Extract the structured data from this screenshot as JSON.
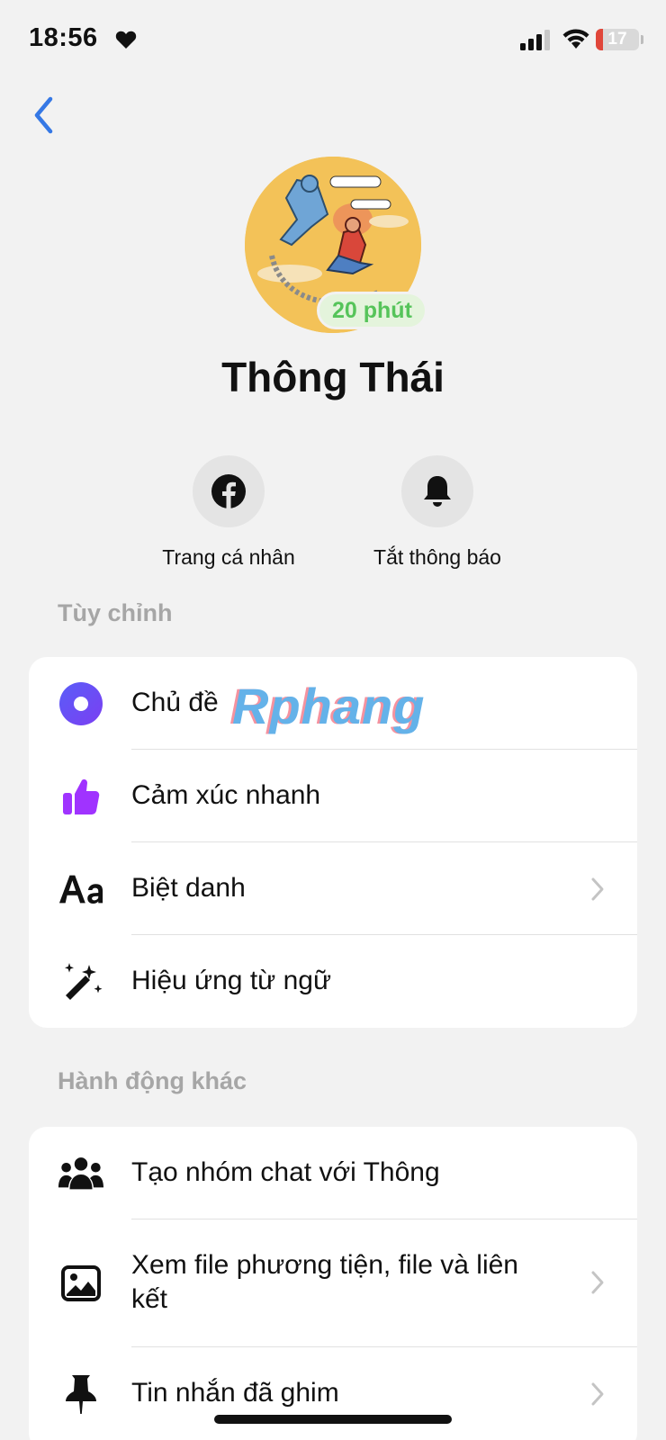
{
  "status_bar": {
    "time": "18:56",
    "battery_level": "17",
    "battery_fraction": 0.17,
    "battery_color": "#e0463a"
  },
  "profile": {
    "name": "Thông Thái",
    "active_badge": "20 phút",
    "active_color": "#56c45a"
  },
  "actions": [
    {
      "label": "Trang cá nhân",
      "icon": "facebook-icon"
    },
    {
      "label": "Tắt thông báo",
      "icon": "bell-icon"
    }
  ],
  "sections": {
    "customize": {
      "title": "Tùy chỉnh",
      "items": [
        {
          "label": "Chủ đề",
          "icon": "theme-circle-icon",
          "chevron": false
        },
        {
          "label": "Cảm xúc nhanh",
          "icon": "thumbs-up-icon",
          "chevron": false
        },
        {
          "label": "Biệt danh",
          "icon": "text-aa-icon",
          "chevron": true
        },
        {
          "label": "Hiệu ứng từ ngữ",
          "icon": "magic-wand-icon",
          "chevron": false
        }
      ]
    },
    "other_actions": {
      "title": "Hành động khác",
      "items": [
        {
          "label": "Tạo nhóm chat với Thông",
          "icon": "group-icon",
          "chevron": false
        },
        {
          "label": "Xem file phương tiện, file và liên kết",
          "icon": "image-icon",
          "chevron": true
        },
        {
          "label": "Tin nhắn đã ghim",
          "icon": "pin-icon",
          "chevron": true
        }
      ]
    }
  },
  "watermark": "Rphang",
  "colors": {
    "accent_blue": "#3578e5",
    "theme_purple": "#7b3ff2",
    "like_purple": "#a033ff"
  }
}
